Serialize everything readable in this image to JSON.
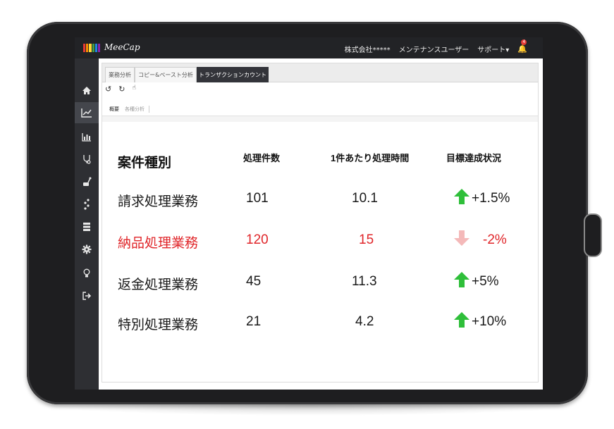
{
  "app": {
    "logo_text": "MeeCap",
    "logo_colors": [
      "#e53935",
      "#fb8c00",
      "#fdd835",
      "#43a047",
      "#1e88e5",
      "#8e24aa"
    ],
    "company": "株式会社*****",
    "user": "メンテナンスユーザー",
    "support": "サポート▾",
    "notification_count": "4"
  },
  "sidebar": {
    "items": [
      {
        "name": "home-icon",
        "glyph": "⌂"
      },
      {
        "name": "trend-chart-icon",
        "glyph": "📈"
      },
      {
        "name": "bar-chart-icon",
        "glyph": "▥"
      },
      {
        "name": "stethoscope-icon",
        "glyph": "☤"
      },
      {
        "name": "mouse-icon",
        "glyph": "✎"
      },
      {
        "name": "footprints-icon",
        "glyph": "⁝"
      },
      {
        "name": "server-icon",
        "glyph": "☰"
      },
      {
        "name": "gear-icon",
        "glyph": "⚙"
      },
      {
        "name": "lightbulb-icon",
        "glyph": "♀"
      },
      {
        "name": "logout-icon",
        "glyph": "↦"
      }
    ]
  },
  "tabs": [
    {
      "label": "業務分析"
    },
    {
      "label": "コピー&ペースト分析"
    },
    {
      "label": "トランザクションカウント"
    }
  ],
  "toolbar": {
    "undo": "↺",
    "redo": "↻",
    "pointer": "☝"
  },
  "subtabs": {
    "active": "概要",
    "inactive": "各種分析"
  },
  "table": {
    "headers": [
      "案件種別",
      "処理件数",
      "1件あたり処理時間",
      "目標達成状況"
    ],
    "rows": [
      {
        "type": "請求処理業務",
        "count": "101",
        "time": "10.1",
        "status": "+1.5%",
        "trend": "up",
        "color": "#1a1a1a"
      },
      {
        "type": "納品処理業務",
        "count": "120",
        "time": "15",
        "status": "-2%",
        "trend": "down",
        "color": "#e0262a"
      },
      {
        "type": "返金処理業務",
        "count": "45",
        "time": "11.3",
        "status": "+5%",
        "trend": "up",
        "color": "#1a1a1a"
      },
      {
        "type": "特別処理業務",
        "count": "21",
        "time": "4.2",
        "status": "+10%",
        "trend": "up",
        "color": "#1a1a1a"
      }
    ]
  },
  "colors": {
    "up_arrow": "#2fbf3a",
    "down_arrow": "#f4b9b9"
  }
}
